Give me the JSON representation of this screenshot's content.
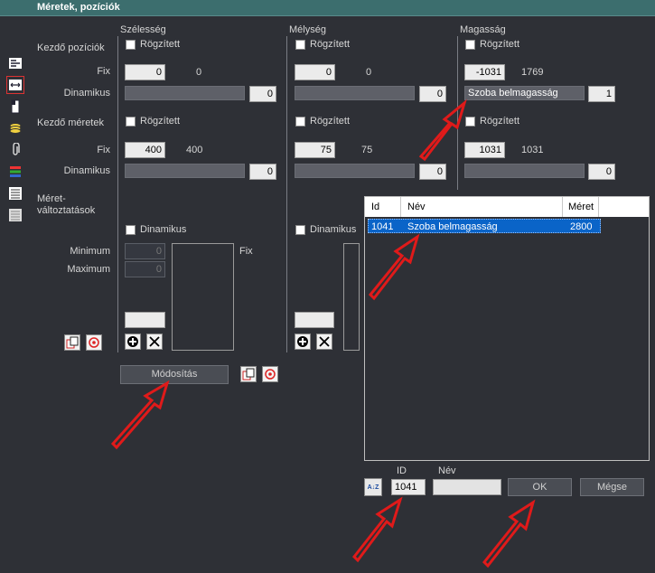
{
  "window": {
    "title": "Méretek, pozíciók"
  },
  "columns": {
    "width": "Szélesség",
    "depth": "Mélység",
    "height": "Magasság"
  },
  "rows": {
    "start_position": "Kezdő pozíciók",
    "start_size": "Kezdő méretek",
    "size_changes_line1": "Méret-",
    "size_changes_line2": "változtatások",
    "fix": "Fix",
    "dynamic": "Dinamikus",
    "minimum": "Minimum",
    "maximum": "Maximum"
  },
  "checkbox_labels": {
    "fixed": "Rögzített",
    "dynamic": "Dinamikus"
  },
  "position": {
    "width": {
      "fix_value": "0",
      "fix_display": "0",
      "dyn_value": "0"
    },
    "depth": {
      "fix_value": "0",
      "fix_display": "0",
      "dyn_value": "0"
    },
    "height": {
      "fix_value": "-1031",
      "fix_display": "1769",
      "dyn_name": "Szoba belmagasság",
      "dyn_value": "1"
    }
  },
  "size": {
    "width": {
      "fix_value": "400",
      "fix_display": "400",
      "dyn_value": "0"
    },
    "depth": {
      "fix_value": "75",
      "fix_display": "75",
      "dyn_value": "0"
    },
    "height": {
      "fix_value": "1031",
      "fix_display": "1031",
      "dyn_value": "0"
    }
  },
  "size_change": {
    "min_value": "0",
    "max_value": "0",
    "fix_label": "Fix",
    "modify_button": "Módosítás"
  },
  "picker": {
    "headers": {
      "id": "Id",
      "name": "Név",
      "size": "Méret"
    },
    "rows": [
      {
        "id": "1041",
        "name": "Szoba belmagasság",
        "size": "2800"
      }
    ],
    "id_label": "ID",
    "name_label": "Név",
    "id_value": "1041",
    "name_value": "",
    "sort_icon_text": "A↓Z",
    "ok_button": "OK",
    "cancel_button": "Mégse"
  },
  "icons": [
    "align-left-icon",
    "width-arrows-icon",
    "door-icon",
    "coins-icon",
    "paperclip-icon",
    "color-bars-icon",
    "list-icon",
    "list-lines-icon",
    "copy-icon",
    "target-icon",
    "add-icon",
    "delete-icon",
    "sort-icon",
    "annotation-arrow-icon"
  ],
  "colors": {
    "background": "#2e3036",
    "title_bar": "#3c6e6e",
    "selection": "#0a64c8",
    "arrow": "#e01a1a"
  }
}
